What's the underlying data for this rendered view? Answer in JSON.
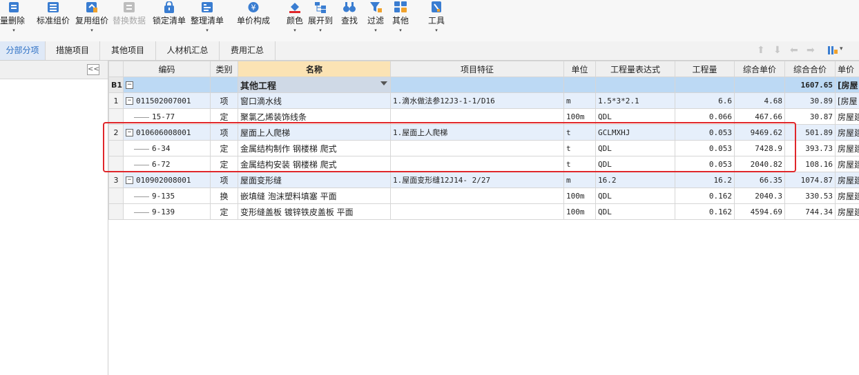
{
  "toolbar": {
    "items": [
      {
        "label": "量删除"
      },
      {
        "label": "标准组价"
      },
      {
        "label": "复用组价"
      },
      {
        "label": "替换数据"
      },
      {
        "label": "锁定清单"
      },
      {
        "label": "整理清单"
      },
      {
        "label": "单价构成"
      },
      {
        "label": "颜色"
      },
      {
        "label": "展开到"
      },
      {
        "label": "查找"
      },
      {
        "label": "过滤"
      },
      {
        "label": "其他"
      },
      {
        "label": "工具"
      }
    ],
    "dropdown_arrow": "▾"
  },
  "tabs": [
    {
      "label": "分部分项"
    },
    {
      "label": "措施项目"
    },
    {
      "label": "其他项目"
    },
    {
      "label": "人材机汇总"
    },
    {
      "label": "费用汇总"
    }
  ],
  "left_panel": {
    "collapse_label": "<<"
  },
  "columns": [
    "编码",
    "类别",
    "名称",
    "项目特征",
    "单位",
    "工程量表达式",
    "工程量",
    "综合单价",
    "综合合价",
    "单价"
  ],
  "section": {
    "label": "B1",
    "expander": "−",
    "name": "其他工程",
    "total": "1607.65",
    "unit_price": "[房屋"
  },
  "rows": [
    {
      "num": "1",
      "code": "011502007001",
      "type": "项",
      "name": "窗口滴水线",
      "feature": "1.滴水做法参12J3-1-1/D16",
      "unit": "m",
      "expr": "1.5*3*2.1",
      "qty": "6.6",
      "price": "4.68",
      "total": "30.89",
      "last": "[房屋"
    },
    {
      "num": "",
      "code": "15-77",
      "type": "定",
      "name": "聚氯乙烯装饰线条",
      "feature": "",
      "unit": "100m",
      "expr": "QDL",
      "qty": "0.066",
      "price": "467.66",
      "total": "30.87",
      "last": "房屋建"
    },
    {
      "num": "2",
      "code": "010606008001",
      "type": "项",
      "name": "屋面上人爬梯",
      "feature": "1.屋面上人爬梯",
      "unit": "t",
      "expr": "GCLMXHJ",
      "qty": "0.053",
      "price": "9469.62",
      "total": "501.89",
      "last": "房屋建"
    },
    {
      "num": "",
      "code": "6-34",
      "type": "定",
      "name": "金属结构制作 钢楼梯 爬式",
      "feature": "",
      "unit": "t",
      "expr": "QDL",
      "qty": "0.053",
      "price": "7428.9",
      "total": "393.73",
      "last": "房屋建"
    },
    {
      "num": "",
      "code": "6-72",
      "type": "定",
      "name": "金属结构安装 钢楼梯 爬式",
      "feature": "",
      "unit": "t",
      "expr": "QDL",
      "qty": "0.053",
      "price": "2040.82",
      "total": "108.16",
      "last": "房屋建"
    },
    {
      "num": "3",
      "code": "010902008001",
      "type": "项",
      "name": "屋面变形缝",
      "feature": "1.屋面变形缝12J14- 2/27",
      "unit": "m",
      "expr": "16.2",
      "qty": "16.2",
      "price": "66.35",
      "total": "1074.87",
      "last": "房屋建"
    },
    {
      "num": "",
      "code": "9-135",
      "type": "换",
      "name": "嵌填缝 泡沫塑料填塞 平面",
      "feature": "",
      "unit": "100m",
      "expr": "QDL",
      "qty": "0.162",
      "price": "2040.3",
      "total": "330.53",
      "last": "房屋建"
    },
    {
      "num": "",
      "code": "9-139",
      "type": "定",
      "name": "变形缝盖板 镀锌铁皮盖板 平面",
      "feature": "",
      "unit": "100m",
      "expr": "QDL",
      "qty": "0.162",
      "price": "4594.69",
      "total": "744.34",
      "last": "房屋建"
    }
  ],
  "colors": {
    "accent": "#2b6fc4",
    "highlight_box": "#e0262a",
    "section_bg": "#bcd9f4",
    "item_bg": "#e6effb"
  }
}
